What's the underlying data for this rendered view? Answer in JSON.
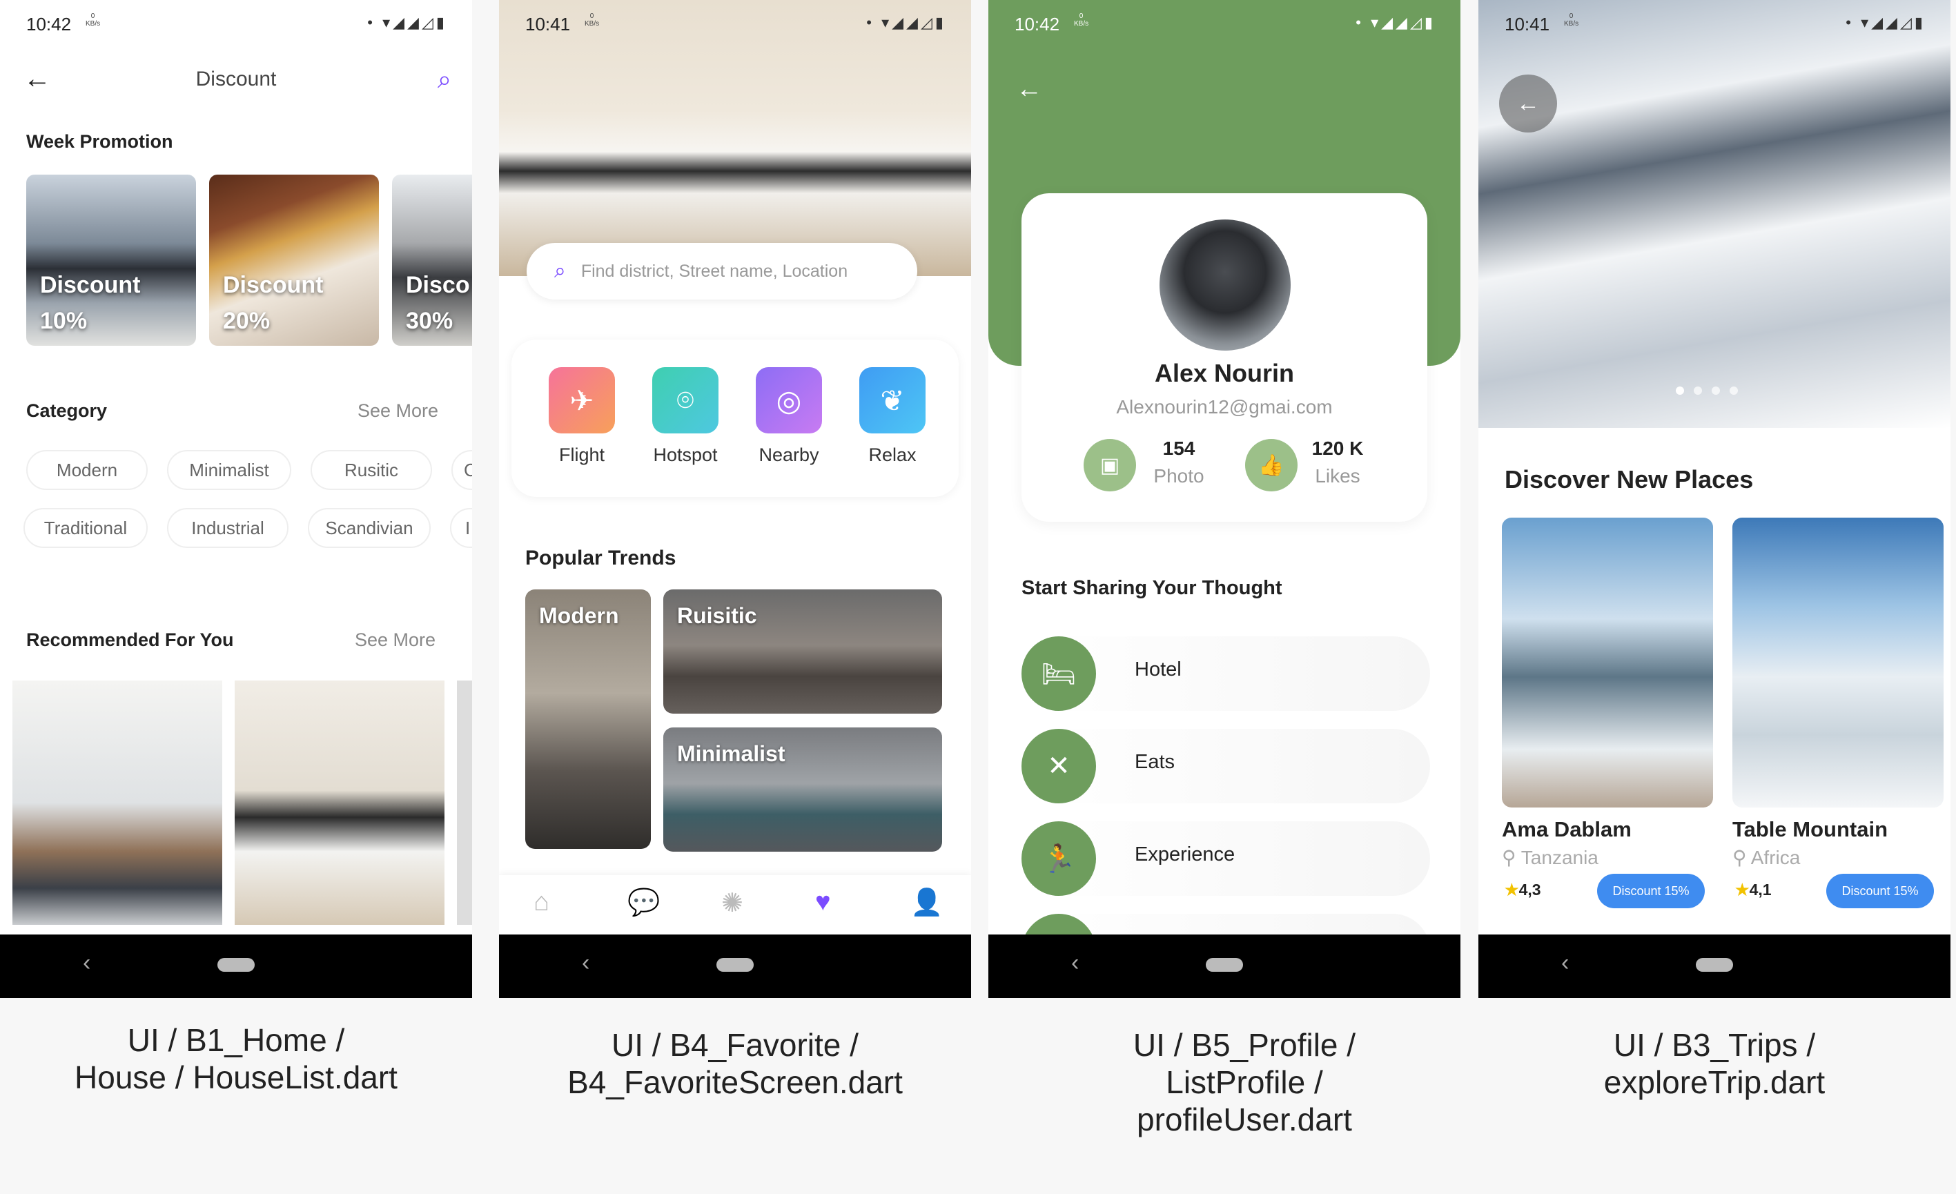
{
  "status_bar": {
    "kb_label": "0\nKB/s",
    "signal": "• ▾◢◢◿▮"
  },
  "screens": [
    {
      "time": "10:42",
      "title": "Discount",
      "week_promotion": "Week Promotion",
      "promos": [
        {
          "label": "Discount",
          "value": "10%"
        },
        {
          "label": "Discount",
          "value": "20%"
        },
        {
          "label": "Disco",
          "value": "30%"
        }
      ],
      "category": "Category",
      "see_more": "See More",
      "chips_row1": [
        "Modern",
        "Minimalist",
        "Rusitic",
        "C"
      ],
      "chips_row2": [
        "Traditional",
        "Industrial",
        "Scandivian",
        "I"
      ],
      "recommended": "Recommended For You",
      "see_more2": "See More",
      "caption": [
        "UI /  B1_Home /",
        "House / HouseList.dart"
      ]
    },
    {
      "time": "10:41",
      "search_placeholder": "Find district, Street name, Location",
      "categories": [
        "Flight",
        "Hotspot",
        "Nearby",
        "Relax"
      ],
      "popular": "Popular Trends",
      "trends": [
        "Modern",
        "Ruisitic",
        "Minimalist"
      ],
      "caption": [
        "UI /  B4_Favorite /",
        "B4_FavoriteScreen.dart"
      ]
    },
    {
      "time": "10:42",
      "name": "Alex Nourin",
      "email": "Alexnourin12@gmai.com",
      "photo_count": "154",
      "photo_label": "Photo",
      "likes_count": "120 K",
      "likes_label": "Likes",
      "sharing": "Start Sharing Your Thought",
      "items": [
        "Hotel",
        "Eats",
        "Experience"
      ],
      "caption": [
        "UI /  B5_Profile /",
        "ListProfile /",
        "profileUser.dart"
      ]
    },
    {
      "time": "10:41",
      "discover": "Discover New Places",
      "places": [
        {
          "name": "Ama Dablam",
          "location": "Tanzania",
          "rating": "4,3",
          "discount": "Discount 15%"
        },
        {
          "name": "Table Mountain",
          "location": "Africa",
          "rating": "4,1",
          "discount": "Discount 15%"
        }
      ],
      "caption": [
        "UI /  B3_Trips /",
        "exploreTrip.dart"
      ]
    }
  ],
  "colors": {
    "purple": "#7b4cff",
    "green": "#6e9d5d",
    "blue": "#3f8cf0"
  }
}
